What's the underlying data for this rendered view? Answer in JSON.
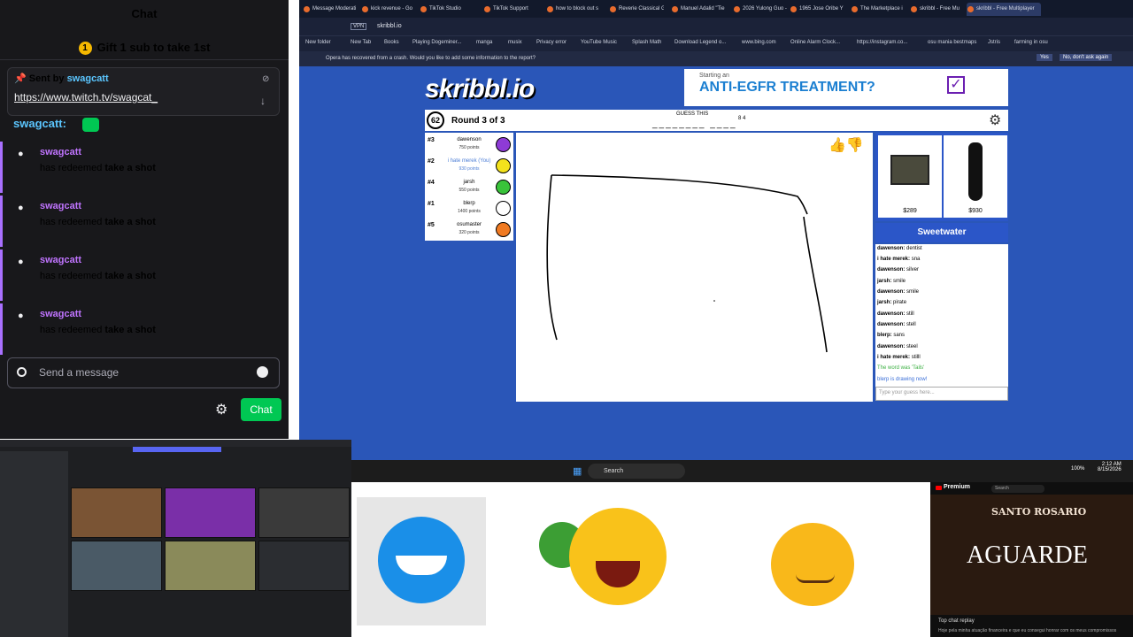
{
  "twitch": {
    "title": "Chat",
    "gift_text": "Gift 1 sub to take 1st",
    "gift_coin": "1",
    "pin_sent_label": "Sent by",
    "pin_sent_user": "swagcatt",
    "pin_link": "https://www.twitch.tv/swagcat_",
    "chat_user": "swagcatt:",
    "redeems": [
      {
        "user": "swagcatt",
        "text": "has redeemed",
        "reward": "take a shot"
      },
      {
        "user": "swagcatt",
        "text": "has redeemed",
        "reward": "take a shot"
      },
      {
        "user": "swagcatt",
        "text": "has redeemed",
        "reward": "take a shot"
      },
      {
        "user": "swagcatt",
        "text": "has redeemed",
        "reward": "take a shot"
      }
    ],
    "send_placeholder": "Send a message",
    "chat_button": "Chat"
  },
  "browser": {
    "tabs": [
      "Message Moderati",
      "kick revenue - Go",
      "TikTok Studio",
      "TikTok Support",
      "how to block out s",
      "Reverie Classical G",
      "Manuel Adalid \"Tie",
      "2026 Yulong Guo -",
      "1965 Jose Oribe Y",
      "The Marketplace i",
      "skribbl - Free Mu",
      "skribbl - Free Multiplayer"
    ],
    "url": "skribbl.io",
    "vpn": "VPN",
    "bookmarks": [
      "New folder",
      "New Tab",
      "Books",
      "Playing Dogeminer...",
      "manga",
      "musix",
      "Privacy error",
      "YouTube Music",
      "Splash Math",
      "Download Legend o...",
      "www.bing.com",
      "Online Alarm Clock...",
      "https://instagram.co...",
      "osu mania bestmaps",
      "Jstris",
      "farming in osu"
    ],
    "crash_message": "Opera has recovered from a crash. Would you like to add some information to the report?",
    "crash_yes": "Yes",
    "crash_no": "No, don't ask again"
  },
  "skribbl": {
    "logo": "skribbl.io",
    "ad_top": "Starting an",
    "ad_main": "ANTI-EGFR TREATMENT?",
    "timer": "62",
    "round": "Round 3 of 3",
    "guess_label": "GUESS THIS",
    "guess_word": "________ ____",
    "guess_lengths": "8 4",
    "players": [
      {
        "rank": "#3",
        "name": "dawenson",
        "points": "750 points",
        "color": "#8e3bd6",
        "me": false
      },
      {
        "rank": "#2",
        "name": "i hate merek (You)",
        "points": "930 points",
        "color": "#f3e21c",
        "me": true
      },
      {
        "rank": "#4",
        "name": "jarsh",
        "points": "550 points",
        "color": "#39c33a",
        "me": false
      },
      {
        "rank": "#1",
        "name": "blerp",
        "points": "1400 points",
        "color": "#ffffff",
        "me": false
      },
      {
        "rank": "#5",
        "name": "osumaster",
        "points": "320 points",
        "color": "#f07a22",
        "me": false
      }
    ],
    "products": [
      {
        "price": "$289"
      },
      {
        "price": "$930"
      }
    ],
    "sponsor": "Sweetwater",
    "messages": [
      {
        "user": "dawenson:",
        "text": "dentist",
        "color": "#000"
      },
      {
        "user": "i hate merek:",
        "text": "sna",
        "color": "#000"
      },
      {
        "user": "dawenson:",
        "text": "silver",
        "color": "#000"
      },
      {
        "user": "jarsh:",
        "text": "smile",
        "color": "#000"
      },
      {
        "user": "dawenson:",
        "text": "smile",
        "color": "#000"
      },
      {
        "user": "jarsh:",
        "text": "pirate",
        "color": "#000"
      },
      {
        "user": "dawenson:",
        "text": "still",
        "color": "#000"
      },
      {
        "user": "dawenson:",
        "text": "stell",
        "color": "#000"
      },
      {
        "user": "blerp:",
        "text": "sans",
        "color": "#000"
      },
      {
        "user": "dawenson:",
        "text": "steel",
        "color": "#000"
      },
      {
        "user": "i hate merek:",
        "text": "stilll",
        "color": "#000"
      },
      {
        "user": "",
        "text": "The word was 'Tails'",
        "color": "#3cb043"
      },
      {
        "user": "",
        "text": "blerp is drawing now!",
        "color": "#3a6fd8"
      }
    ],
    "guess_placeholder": "Type your guess here..."
  },
  "taskbar": {
    "search": "Search",
    "battery": "100%",
    "time": "2:12 AM",
    "date": "8/15/2026"
  },
  "youtube": {
    "brand": "Premium",
    "search": "Search",
    "title_top": "SANTO ROSARIO",
    "title_main": "AGUARDE",
    "chat_label": "Top chat replay",
    "chat_msg": "Hoje pela minha atuação financeira e que eu consegui honrar com os meus compromissos"
  }
}
